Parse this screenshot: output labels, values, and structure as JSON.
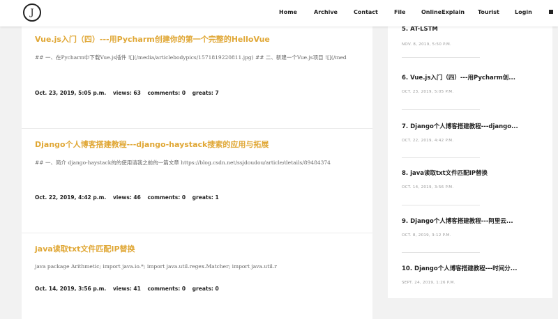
{
  "header": {
    "logo_text": "J",
    "nav": [
      {
        "label": "Home"
      },
      {
        "label": "Archive"
      },
      {
        "label": "Contact"
      },
      {
        "label": "File"
      },
      {
        "label": "OnlineExplain"
      },
      {
        "label": "Tourist"
      },
      {
        "label": "Login"
      }
    ]
  },
  "posts": [
    {
      "title": "Vue.js入门（四）---用Pycharm创建你的第一个完整的HelloVue",
      "excerpt": "## 一、在Pycharm中下载Vue.js插件 ![](/media/articlebodypics/1571819220811.jpg) ## 二、新建一个Vue.js项目 ![](/med",
      "date": "Oct. 23, 2019, 5:05 p.m.",
      "views": "views:  63",
      "comments": "comments:  0",
      "greats": "greats:  7"
    },
    {
      "title": "Django个人博客搭建教程---django-haystack搜索的应用与拓展",
      "excerpt": "## 一、简介 django-haystack的的使用请我之前的一篇文章 https://blog.csdn.net/ssjdoudou/article/details/89484374",
      "date": "Oct. 22, 2019, 4:42 p.m.",
      "views": "views:  46",
      "comments": "comments:  0",
      "greats": "greats:  1"
    },
    {
      "title": "java读取txt文件匹配IP替换",
      "excerpt": "java package Arithmetic; import java.io.*; import java.util.regex.Matcher; import java.util.r",
      "date": "Oct. 14, 2019, 3:56 p.m.",
      "views": "views:  41",
      "comments": "comments:  0",
      "greats": "greats:  0"
    }
  ],
  "sidebar": {
    "items": [
      {
        "title": "5. AT-LSTM",
        "date": "NOV. 8, 2019, 5:50 P.M."
      },
      {
        "title": "6. Vue.js入门（四）---用Pycharm创...",
        "date": "OCT. 23, 2019, 5:05 P.M."
      },
      {
        "title": "7. Django个人博客搭建教程---django...",
        "date": "OCT. 22, 2019, 4:42 P.M."
      },
      {
        "title": "8. java读取txt文件匹配IP替换",
        "date": "OCT. 14, 2019, 3:56 P.M."
      },
      {
        "title": "9. Django个人博客搭建教程---阿里云...",
        "date": "OCT. 8, 2019, 3:12 P.M."
      },
      {
        "title": "10. Django个人博客搭建教程---时间分...",
        "date": "SEPT. 24, 2019, 1:26 P.M."
      }
    ]
  },
  "colors": {
    "accent": "#e0a735",
    "text": "#222222",
    "muted": "#999999",
    "background": "#f2f2f2"
  }
}
